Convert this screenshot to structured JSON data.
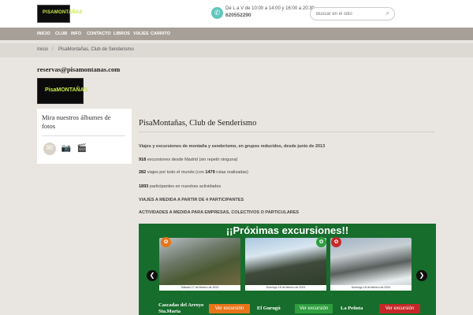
{
  "header": {
    "logo_text": "PISAMONTAÑAS",
    "hours": "De L a V de 10:00 a 14:00 y 16:00 a 20:30",
    "phone": "620552290",
    "search_placeholder": "Buscar en el sitio"
  },
  "nav": [
    "INICIO",
    "CLUB",
    "INFO",
    "CONTACTO",
    "LIBROS",
    "VIAJES",
    "CARRITO"
  ],
  "breadcrumb": [
    "Inicio",
    "/",
    "PisaMontañas, Club de Senderismo"
  ],
  "sidebar": {
    "email": "reservas@pisamontanas.com",
    "logo_text": "PisaMONTAÑAS",
    "album_title": "Mira nuestros álbumes de fotos",
    "icons": [
      "email-icon",
      "camera-icon",
      "video-icon"
    ]
  },
  "main": {
    "title": "PisaMontañas, Club de Senderismo",
    "intro": "Viajes y excursiones de montaña y senderismo, en grupos reducidos, desde junio de 2013",
    "stats": [
      {
        "num": "918",
        "text": " excursiones desde Madrid (sin repetir ninguna)",
        "num2": "",
        "text2": ""
      },
      {
        "num": "282",
        "text": " viajes por todo el mundo (con ",
        "num2": "1479",
        "text2": " rutas realizadas)"
      },
      {
        "num": "1893",
        "text": " participantes en nuestras actividades",
        "num2": "",
        "text2": ""
      }
    ],
    "line1": "VIAJES A MEDIDA A PARTIR DE 4 PARTICIPANTES",
    "line2": "ACTIVIDADES A MEDIDA PARA EMPRESAS, COLECTIVOS O PARTICULARES"
  },
  "banner": {
    "title": "¡¡Próximas excursiones!!",
    "photos": [
      {
        "date": "Sábado 17 de febrero de 2024",
        "caption": "Cascadas del Arroyo Sta.María",
        "button": "Ver excursión",
        "button_color": "#e8751a"
      },
      {
        "date": "Domingo 18 de febrero de 2024",
        "caption": "El Gurugú",
        "button": "Ver excursión",
        "button_color": "#2f9e3f"
      },
      {
        "date": "Domingo 18 de febrero de 2024",
        "caption": "La Peñota",
        "button": "Ver excursión",
        "button_color": "#c62828"
      }
    ]
  },
  "colors": {
    "nav": "#a6a098",
    "banner": "#176d2c",
    "accent": "#5fc6bd"
  }
}
